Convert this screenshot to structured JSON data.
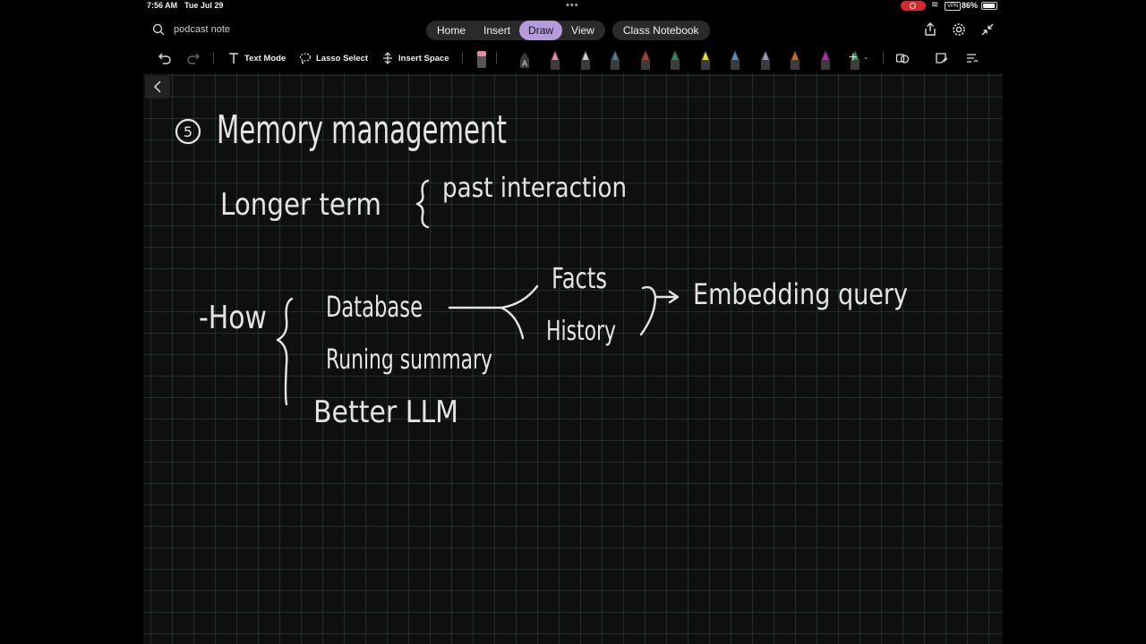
{
  "status": {
    "time": "7:56 AM",
    "date": "Tue Jul 29",
    "vpn": "VPN",
    "battery": "86%"
  },
  "search": {
    "text": "podcast note"
  },
  "tabs": [
    "Home",
    "Insert",
    "Draw",
    "View"
  ],
  "active_tab": "Draw",
  "class_notebook": "Class Notebook",
  "toolbar": {
    "text_mode": "Text Mode",
    "lasso_select": "Lasso Select",
    "insert_space": "Insert Space",
    "highlighter_letter": "A"
  },
  "pen_colors": [
    "#e78aa0",
    "#cfcfcf",
    "#4a7fa0",
    "#c0392b",
    "#2e8b57",
    "#e8e020",
    "#5e8fb8",
    "#9a9ab0",
    "#d2691e",
    "#c020c0",
    "#2aa060"
  ],
  "note": {
    "number": "5",
    "title": "Memory management",
    "line2_left": "Longer term",
    "line2_right": "past interaction",
    "how": "-How",
    "item1": "Database",
    "item2": "Runing summary",
    "item3": "Better LLM",
    "branch1": "Facts",
    "branch2": "History",
    "result": "Embedding query"
  }
}
